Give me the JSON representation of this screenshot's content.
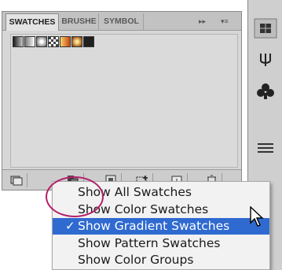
{
  "panel": {
    "tabs": [
      {
        "label": "SWATCHES",
        "active": true
      },
      {
        "label": "BRUSHE",
        "active": false
      },
      {
        "label": "SYMBOL",
        "active": false
      }
    ],
    "tab_controls": {
      "expand": "▸▸",
      "menu": "▾≡"
    }
  },
  "swatches": [
    {
      "name": "gradient-dark",
      "colors": [
        "#1a1a1a",
        "#c8c8c8"
      ]
    },
    {
      "name": "gradient-light",
      "colors": [
        "#777777",
        "#ffffff"
      ]
    },
    {
      "name": "gradient-radial-white",
      "colors": [
        "#ffffff",
        "#555555"
      ]
    },
    {
      "name": "gradient-checker",
      "colors": [
        "#ffffff",
        "#444444"
      ]
    },
    {
      "name": "gradient-orange",
      "colors": [
        "#f7d06a",
        "#c8470f"
      ]
    },
    {
      "name": "gradient-radial-orange",
      "colors": [
        "#ffe08a",
        "#7a2a00"
      ]
    },
    {
      "name": "gradient-black",
      "colors": [
        "#202020",
        "#202020"
      ]
    }
  ],
  "menu": {
    "items": [
      {
        "label": "Show All Swatches",
        "checked": false
      },
      {
        "label": "Show Color Swatches",
        "checked": false
      },
      {
        "label": "Show Gradient Swatches",
        "checked": true
      },
      {
        "label": "Show Pattern Swatches",
        "checked": false
      },
      {
        "label": "Show Color Groups",
        "checked": false
      }
    ],
    "check_glyph": "✓"
  },
  "colors": {
    "highlight": "#2f6ad0",
    "annotation_circle": "#b5206a"
  }
}
